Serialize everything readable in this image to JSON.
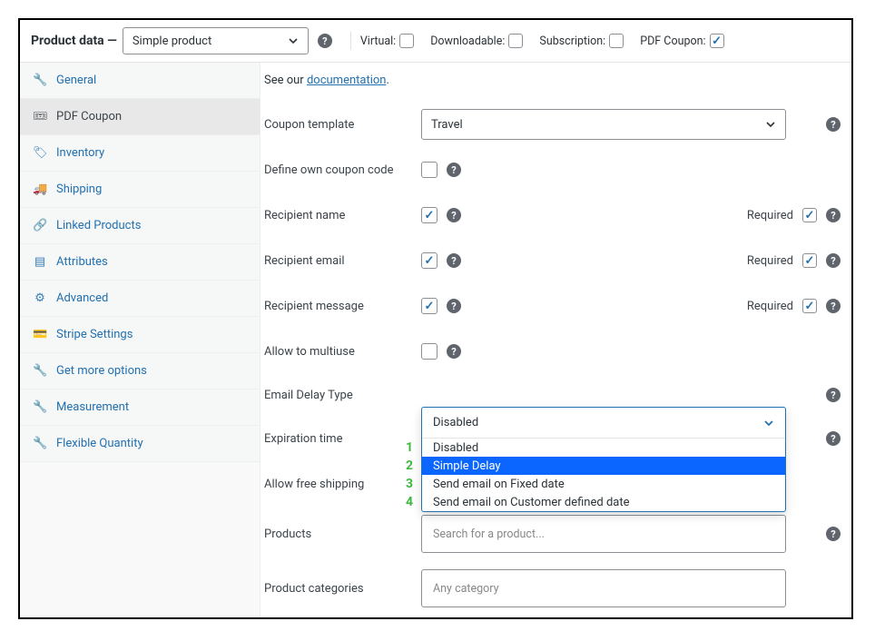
{
  "header": {
    "title": "Product data —",
    "product_type": "Simple product",
    "options": {
      "virtual_label": "Virtual:",
      "downloadable_label": "Downloadable:",
      "subscription_label": "Subscription:",
      "pdf_coupon_label": "PDF Coupon:"
    }
  },
  "sidebar": {
    "items": [
      {
        "label": "General",
        "icon": "wrench-icon"
      },
      {
        "label": "PDF Coupon",
        "icon": "ticket-icon"
      },
      {
        "label": "Inventory",
        "icon": "box-icon"
      },
      {
        "label": "Shipping",
        "icon": "truck-icon"
      },
      {
        "label": "Linked Products",
        "icon": "link-icon"
      },
      {
        "label": "Attributes",
        "icon": "grid-icon"
      },
      {
        "label": "Advanced",
        "icon": "gear-icon"
      },
      {
        "label": "Stripe Settings",
        "icon": "card-icon"
      },
      {
        "label": "Get more options",
        "icon": "wrench-icon"
      },
      {
        "label": "Measurement",
        "icon": "wrench-icon"
      },
      {
        "label": "Flexible Quantity",
        "icon": "wrench-icon"
      }
    ]
  },
  "content": {
    "doc_prefix": "See our ",
    "doc_link": "documentation",
    "doc_suffix": ".",
    "rows": {
      "coupon_template": {
        "label": "Coupon template",
        "value": "Travel"
      },
      "own_code": {
        "label": "Define own coupon code"
      },
      "recipient_name": {
        "label": "Recipient name",
        "required": "Required"
      },
      "recipient_email": {
        "label": "Recipient email",
        "required": "Required"
      },
      "recipient_message": {
        "label": "Recipient message",
        "required": "Required"
      },
      "multiuse": {
        "label": "Allow to multiuse"
      },
      "email_delay": {
        "label": "Email Delay Type",
        "value": "Disabled"
      },
      "expiration": {
        "label": "Expiration time"
      },
      "free_ship": {
        "label": "Allow free shipping"
      },
      "products": {
        "label": "Products",
        "placeholder": "Search for a product..."
      },
      "categories": {
        "label": "Product categories",
        "placeholder": "Any category"
      }
    },
    "dropdown": {
      "options": [
        "Disabled",
        "Simple Delay",
        "Send email on Fixed date",
        "Send email on Customer defined date"
      ],
      "nums": [
        "1",
        "2",
        "3",
        "4"
      ]
    }
  }
}
